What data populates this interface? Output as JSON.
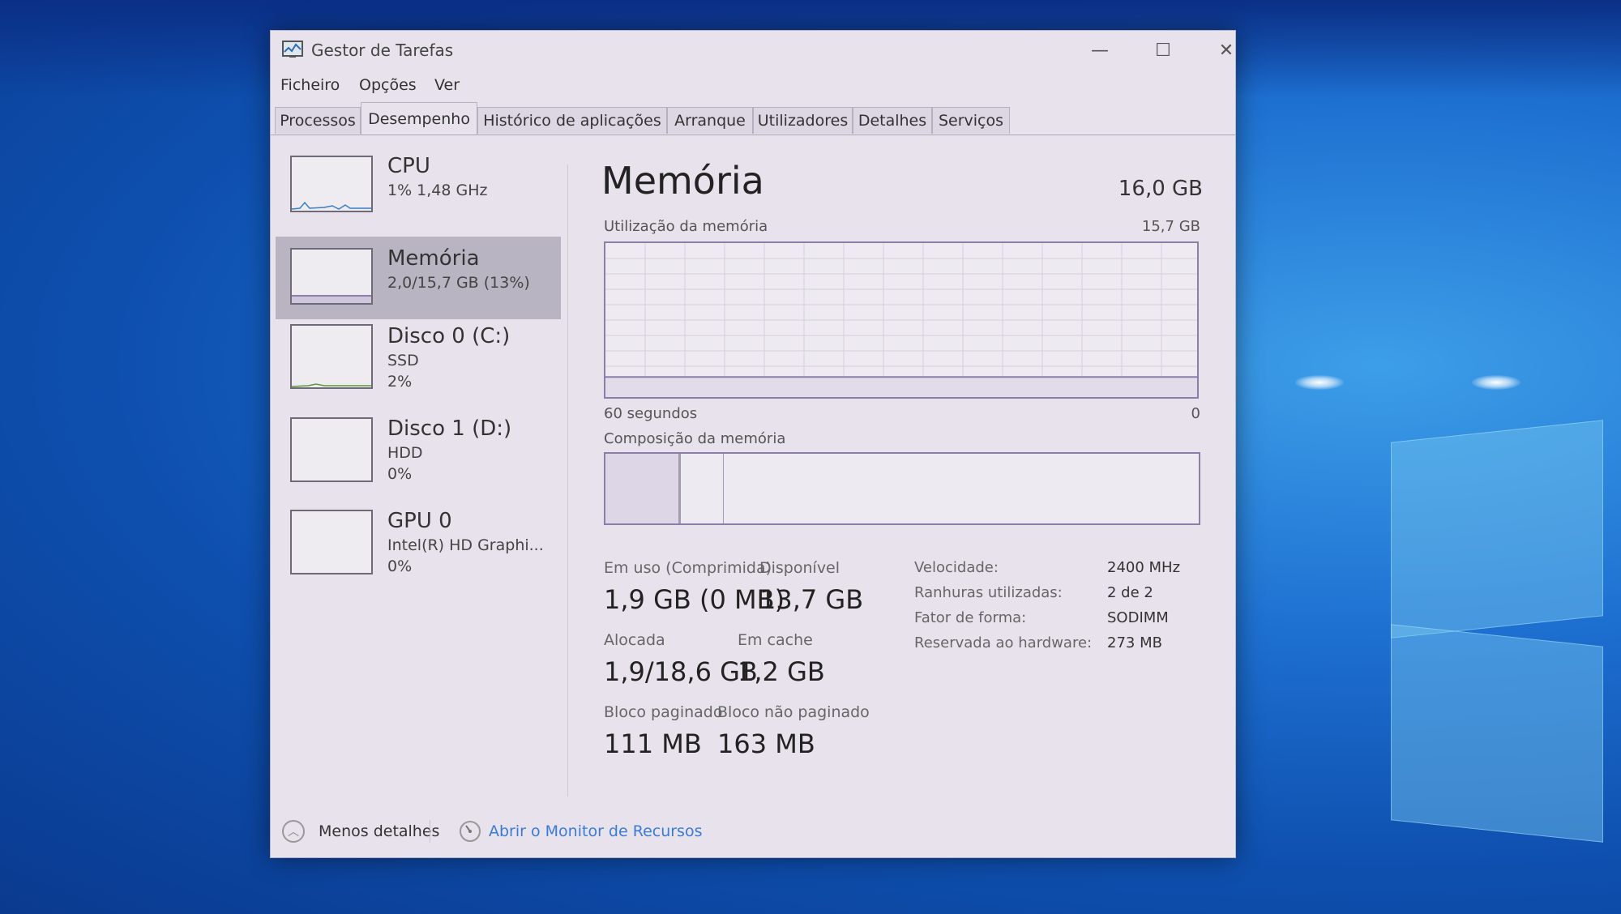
{
  "window": {
    "title": "Gestor de Tarefas",
    "controls": {
      "minimize": "—",
      "maximize": "☐",
      "close": "✕"
    }
  },
  "menu": [
    "Ficheiro",
    "Opções",
    "Ver"
  ],
  "tabs": [
    "Processos",
    "Desempenho",
    "Histórico de aplicações",
    "Arranque",
    "Utilizadores",
    "Detalhes",
    "Serviços"
  ],
  "active_tab": "Desempenho",
  "sidebar": {
    "items": [
      {
        "name": "CPU",
        "line1": "1% 1,48 GHz",
        "line2": ""
      },
      {
        "name": "Memória",
        "line1": "2,0/15,7 GB (13%)",
        "line2": ""
      },
      {
        "name": "Disco 0 (C:)",
        "line1": "SSD",
        "line2": "2%"
      },
      {
        "name": "Disco 1 (D:)",
        "line1": "HDD",
        "line2": "0%"
      },
      {
        "name": "GPU 0",
        "line1": "Intel(R) HD Graphi...",
        "line2": "0%"
      }
    ],
    "selected": "Memória"
  },
  "main": {
    "title": "Memória",
    "total": "16,0 GB",
    "usage_label": "Utilização da memória",
    "usage_max": "15,7 GB",
    "time_left": "60 segundos",
    "time_right": "0",
    "composition_label": "Composição da memória",
    "usage_fraction": 0.13,
    "stats": {
      "in_use_label": "Em uso (Comprimida)",
      "in_use_value": "1,9 GB (0 MB)",
      "available_label": "Disponível",
      "available_value": "13,7 GB",
      "committed_label": "Alocada",
      "committed_value": "1,9/18,6 GB",
      "cached_label": "Em cache",
      "cached_value": "1,2 GB",
      "paged_label": "Bloco paginado",
      "paged_value": "111 MB",
      "nonpaged_label": "Bloco não paginado",
      "nonpaged_value": "163 MB"
    },
    "properties": [
      {
        "label": "Velocidade:",
        "value": "2400 MHz"
      },
      {
        "label": "Ranhuras utilizadas:",
        "value": "2 de 2"
      },
      {
        "label": "Fator de forma:",
        "value": "SODIMM"
      },
      {
        "label": "Reservada ao hardware:",
        "value": "273 MB"
      }
    ]
  },
  "footer": {
    "fewer_details": "Menos detalhes",
    "resource_monitor": "Abrir o Monitor de Recursos"
  },
  "colors": {
    "accent": "#8c7ea8",
    "link": "#3a7bd5",
    "selected": "#b9b4c2"
  }
}
